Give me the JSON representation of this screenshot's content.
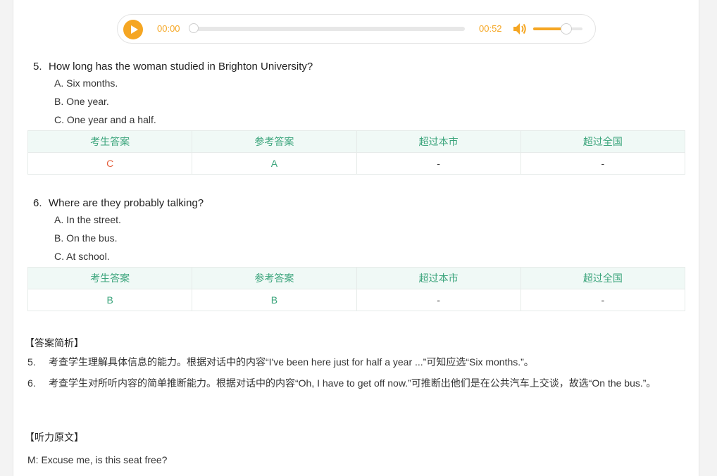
{
  "player": {
    "current_time": "00:00",
    "total_time": "00:52",
    "progress": 0,
    "volume": 0.65,
    "accent_color": "#f5a623",
    "play_icon": "play-icon",
    "volume_icon": "volume-icon"
  },
  "questions": [
    {
      "number": "5.",
      "text": "How long has the woman studied in Brighton University?",
      "options": [
        "A. Six months.",
        "B. One year.",
        "C. One year and a half."
      ],
      "table_headers": [
        "考生答案",
        "参考答案",
        "超过本市",
        "超过全国"
      ],
      "table_values": [
        "C",
        "A",
        "-",
        "-"
      ]
    },
    {
      "number": "6.",
      "text": "Where are they probably talking?",
      "options": [
        "A. In the street.",
        "B. On the bus.",
        "C. At school."
      ],
      "table_headers": [
        "考生答案",
        "参考答案",
        "超过本市",
        "超过全国"
      ],
      "table_values": [
        "B",
        "B",
        "-",
        "-"
      ]
    }
  ],
  "analysis": {
    "heading": "【答案简析】",
    "items": [
      {
        "number": "5.",
        "text": "考查学生理解具体信息的能力。根据对话中的内容“I've been here just for half a year ...”可知应选“Six months.”。"
      },
      {
        "number": "6.",
        "text": "考查学生对所听内容的简单推断能力。根据对话中的内容“Oh, I have to get off now.”可推断出他们是在公共汽车上交谈，故选“On the bus.”。"
      }
    ]
  },
  "transcript": {
    "heading": "【听力原文】",
    "first_line": "M: Excuse me, is this seat free?"
  },
  "colors": {
    "header_green": "#3aa47b",
    "wrong_red": "#e45e3b",
    "header_bg": "#f0f9f6"
  }
}
